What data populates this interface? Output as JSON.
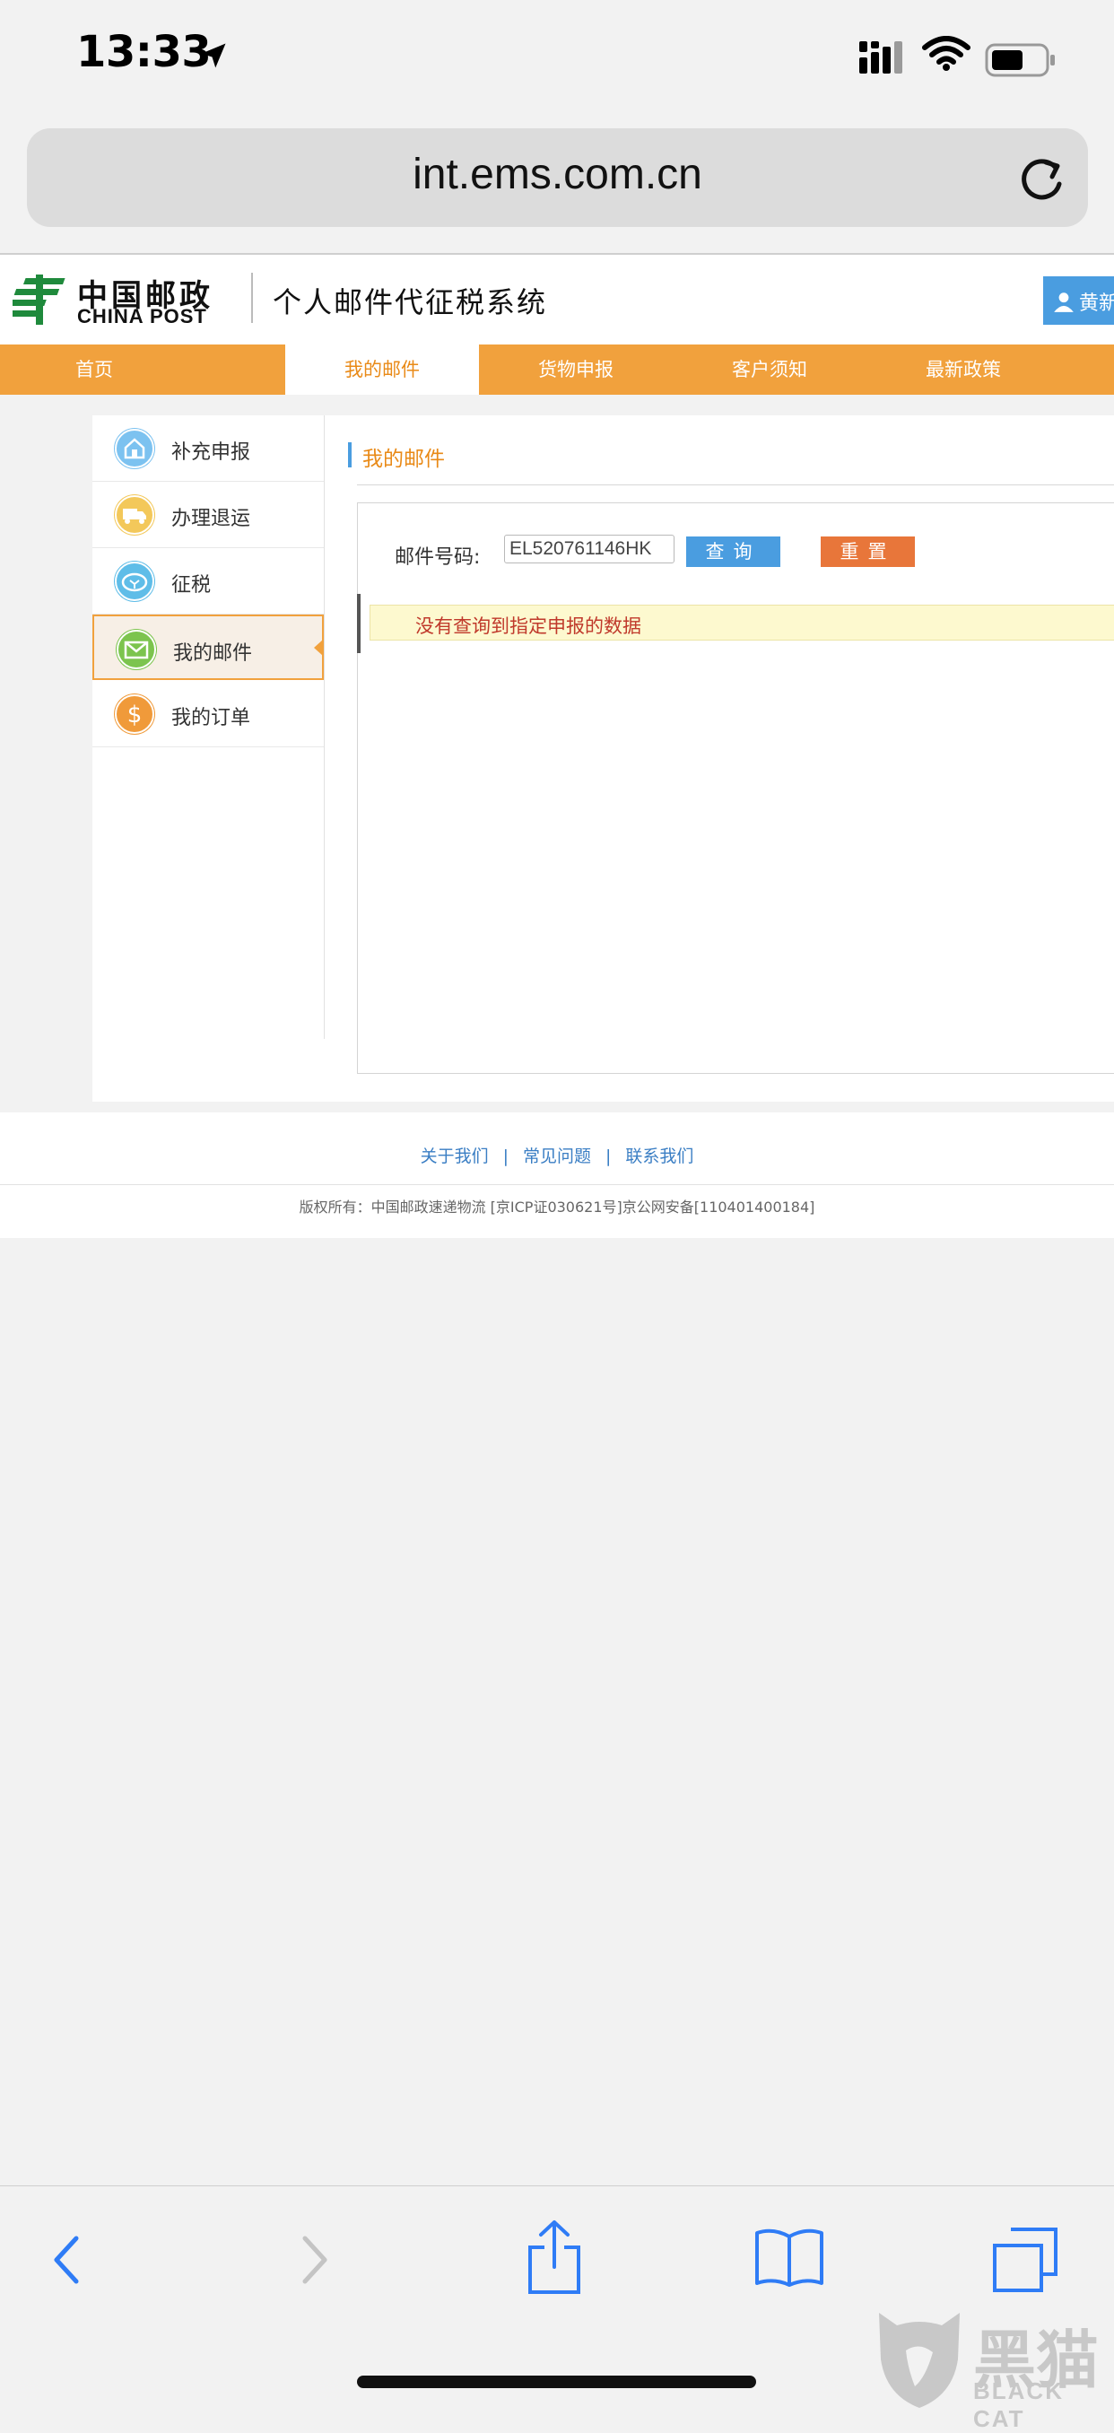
{
  "status_bar": {
    "time": "13:33",
    "icons": [
      "location-arrow-icon",
      "cellular-signal-icon",
      "wifi-icon",
      "battery-icon"
    ]
  },
  "browser": {
    "url": "int.ems.com.cn",
    "toolbar_icons": [
      "back-icon",
      "forward-icon",
      "share-icon",
      "bookmarks-icon",
      "tabs-icon"
    ]
  },
  "header": {
    "logo_cn": "中国邮政",
    "logo_en": "CHINA POST",
    "system_title": "个人邮件代征税系统",
    "user_name": "黄新"
  },
  "nav": {
    "items": [
      {
        "label": "首页",
        "active": false
      },
      {
        "label": "我的邮件",
        "active": true
      },
      {
        "label": "货物申报",
        "active": false
      },
      {
        "label": "客户须知",
        "active": false
      },
      {
        "label": "最新政策",
        "active": false
      }
    ]
  },
  "sidebar": {
    "items": [
      {
        "label": "补充申报",
        "icon": "building-icon",
        "color": "#7cc2f0",
        "active": false
      },
      {
        "label": "办理退运",
        "icon": "truck-icon",
        "color": "#f3c85a",
        "active": false
      },
      {
        "label": "征税",
        "icon": "tax-icon",
        "color": "#5fbde8",
        "active": false
      },
      {
        "label": "我的邮件",
        "icon": "envelope-icon",
        "color": "#7cc44e",
        "active": true
      },
      {
        "label": "我的订单",
        "icon": "dollar-icon",
        "color": "#f09a3a",
        "active": false
      }
    ]
  },
  "main": {
    "section_title": "我的邮件",
    "field_label": "邮件号码:",
    "tracking_number": "EL520761146HK",
    "query_button": "查询",
    "reset_button": "重置",
    "notice": "没有查询到指定申报的数据"
  },
  "footer": {
    "links": [
      "关于我们",
      "常见问题",
      "联系我们"
    ],
    "copyright": "版权所有：中国邮政速递物流 [京ICP证030621号]京公网安备[110401400184]"
  },
  "watermark": {
    "text_cn": "黑猫",
    "text_en": "BLACK CAT"
  },
  "colors": {
    "nav_orange": "#f1a13d",
    "accent_blue": "#4a9de0",
    "reset_orange": "#e8763a",
    "notice_red": "#c0392b"
  }
}
